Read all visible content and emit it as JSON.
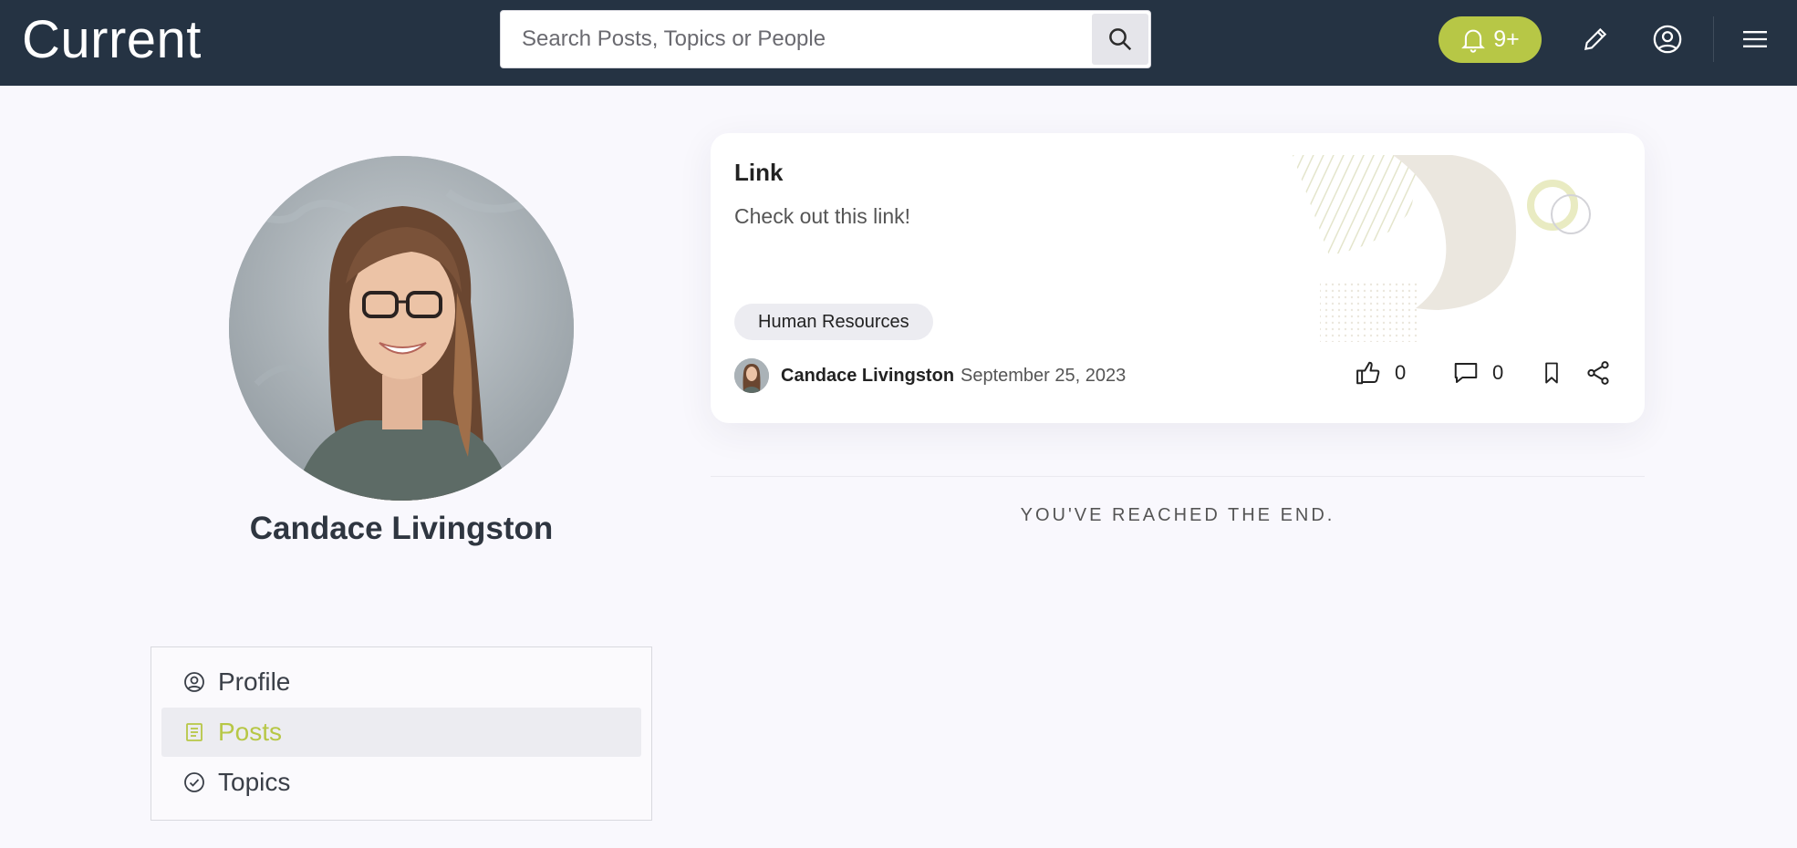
{
  "header": {
    "brand": "Current",
    "search_placeholder": "Search Posts, Topics or People",
    "notifications_count": "9+"
  },
  "profile": {
    "name": "Candace Livingston"
  },
  "side_menu": {
    "items": [
      {
        "label": "Profile",
        "icon": "user-circle-icon",
        "active": false
      },
      {
        "label": "Posts",
        "icon": "document-icon",
        "active": true
      },
      {
        "label": "Topics",
        "icon": "check-circle-icon",
        "active": false
      }
    ]
  },
  "post": {
    "title": "Link",
    "body": "Check out this link!",
    "tag": "Human Resources",
    "author": "Candace Livingston",
    "date": "September 25, 2023",
    "likes": "0",
    "comments": "0"
  },
  "feed": {
    "end_message": "YOU'VE REACHED THE END."
  },
  "colors": {
    "header_bg": "#253343",
    "accent": "#b7c746",
    "page_bg": "#f9f8fd"
  }
}
